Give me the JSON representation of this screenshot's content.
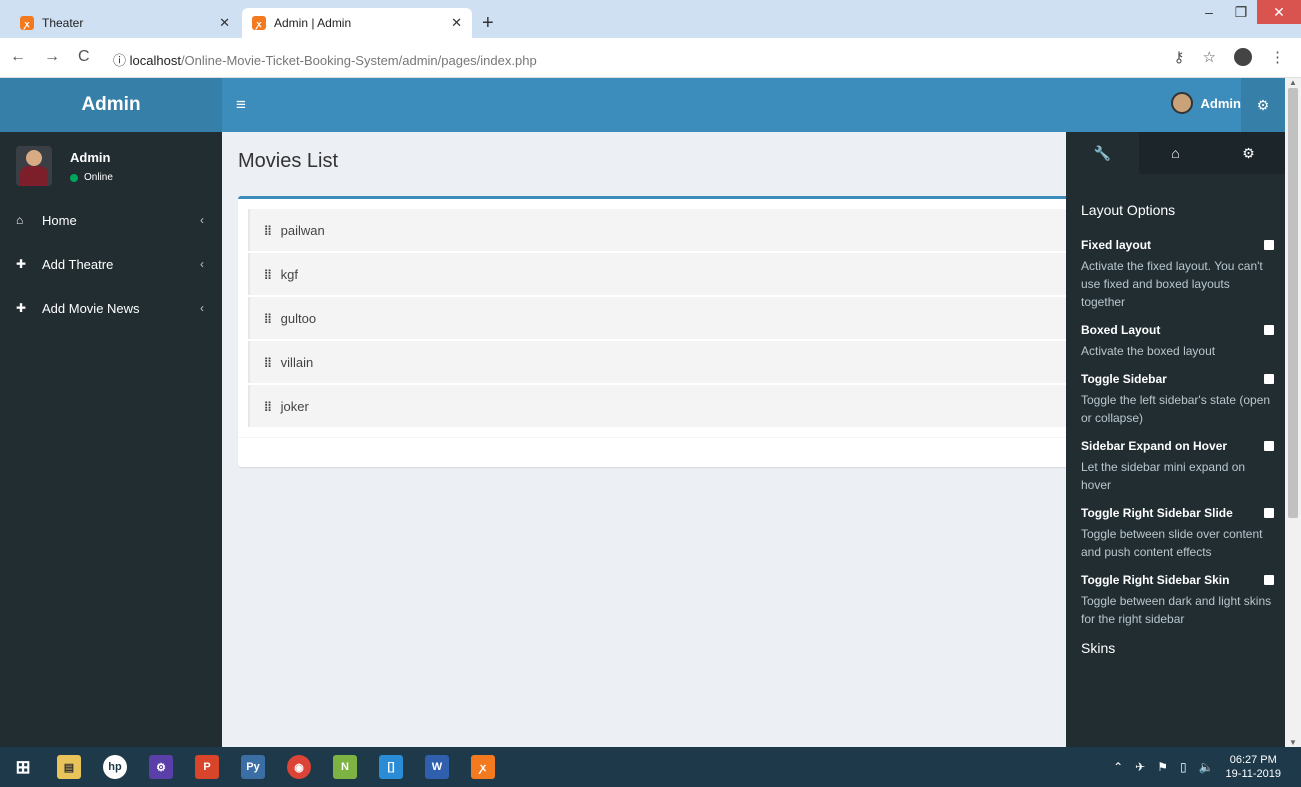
{
  "browser": {
    "tabs": [
      {
        "title": "Theater"
      },
      {
        "title": "Admin | Admin"
      }
    ],
    "url_host": "localhost",
    "url_path": "/Online-Movie-Ticket-Booking-System/admin/pages/index.php"
  },
  "header": {
    "logo": "Admin",
    "user_name": "Admin"
  },
  "sidebar": {
    "user_name": "Admin",
    "status": "Online",
    "items": [
      {
        "label": "Home"
      },
      {
        "label": "Add Theatre"
      },
      {
        "label": "Add Movie News"
      }
    ]
  },
  "main": {
    "title": "Movies List",
    "movies": [
      "pailwan",
      "kgf",
      "gultoo",
      "villain",
      "joker"
    ]
  },
  "right_sidebar": {
    "heading": "Layout Options",
    "options": [
      {
        "title": "Fixed layout",
        "desc": "Activate the fixed layout. You can't use fixed and boxed layouts together"
      },
      {
        "title": "Boxed Layout",
        "desc": "Activate the boxed layout"
      },
      {
        "title": "Toggle Sidebar",
        "desc": "Toggle the left sidebar's state (open or collapse)"
      },
      {
        "title": "Sidebar Expand on Hover",
        "desc": "Let the sidebar mini expand on hover"
      },
      {
        "title": "Toggle Right Sidebar Slide",
        "desc": "Toggle between slide over content and push content effects"
      },
      {
        "title": "Toggle Right Sidebar Skin",
        "desc": "Toggle between dark and light skins for the right sidebar"
      }
    ],
    "skins_label": "Skins"
  },
  "taskbar": {
    "time": "06:27 PM",
    "date": "19-11-2019"
  },
  "colors": {
    "brand": "#3c8dbc",
    "sidebar": "#222d32",
    "online": "#00a65a"
  }
}
